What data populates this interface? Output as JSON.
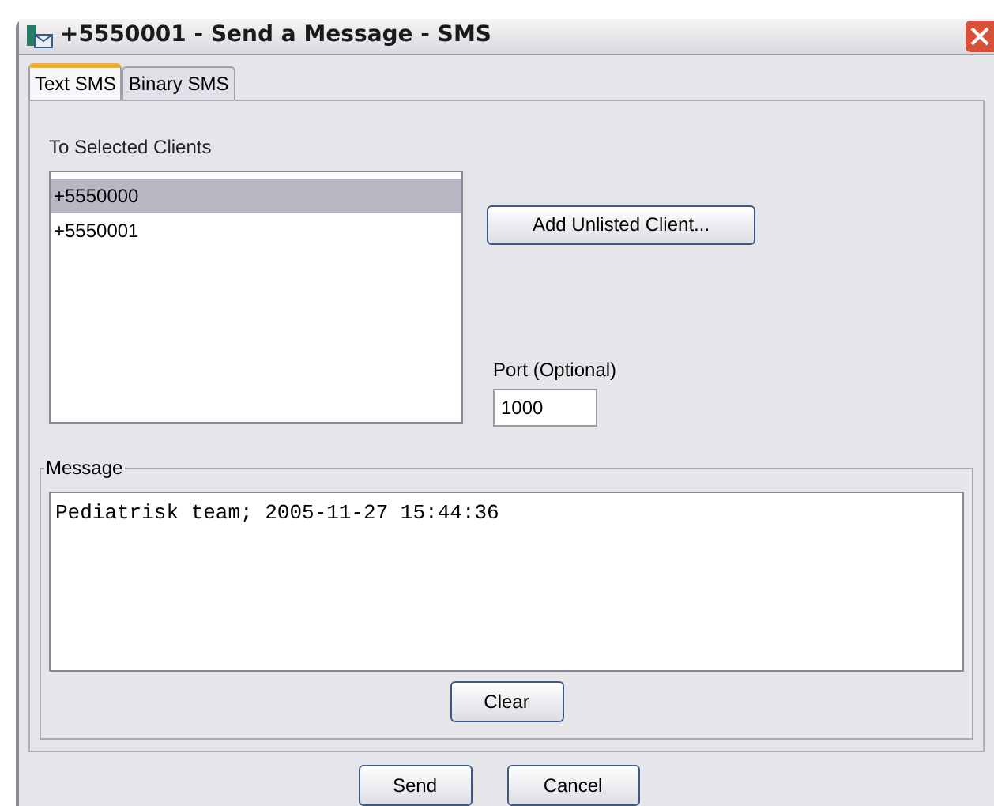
{
  "window": {
    "title": "+5550001 - Send a Message - SMS"
  },
  "tabs": [
    {
      "label": "Text SMS",
      "selected": true
    },
    {
      "label": "Binary SMS",
      "selected": false
    }
  ],
  "clients": {
    "label": "To Selected Clients",
    "items": [
      {
        "label": "+5550000",
        "selected": true
      },
      {
        "label": "+5550001",
        "selected": false
      }
    ]
  },
  "add_button": "Add Unlisted Client...",
  "port": {
    "label": "Port (Optional)",
    "value": "1000"
  },
  "message": {
    "label": "Message",
    "value": "Pediatrisk team; 2005-11-27 15:44:36",
    "clear_button": "Clear"
  },
  "buttons": [
    "Send",
    "Cancel"
  ]
}
